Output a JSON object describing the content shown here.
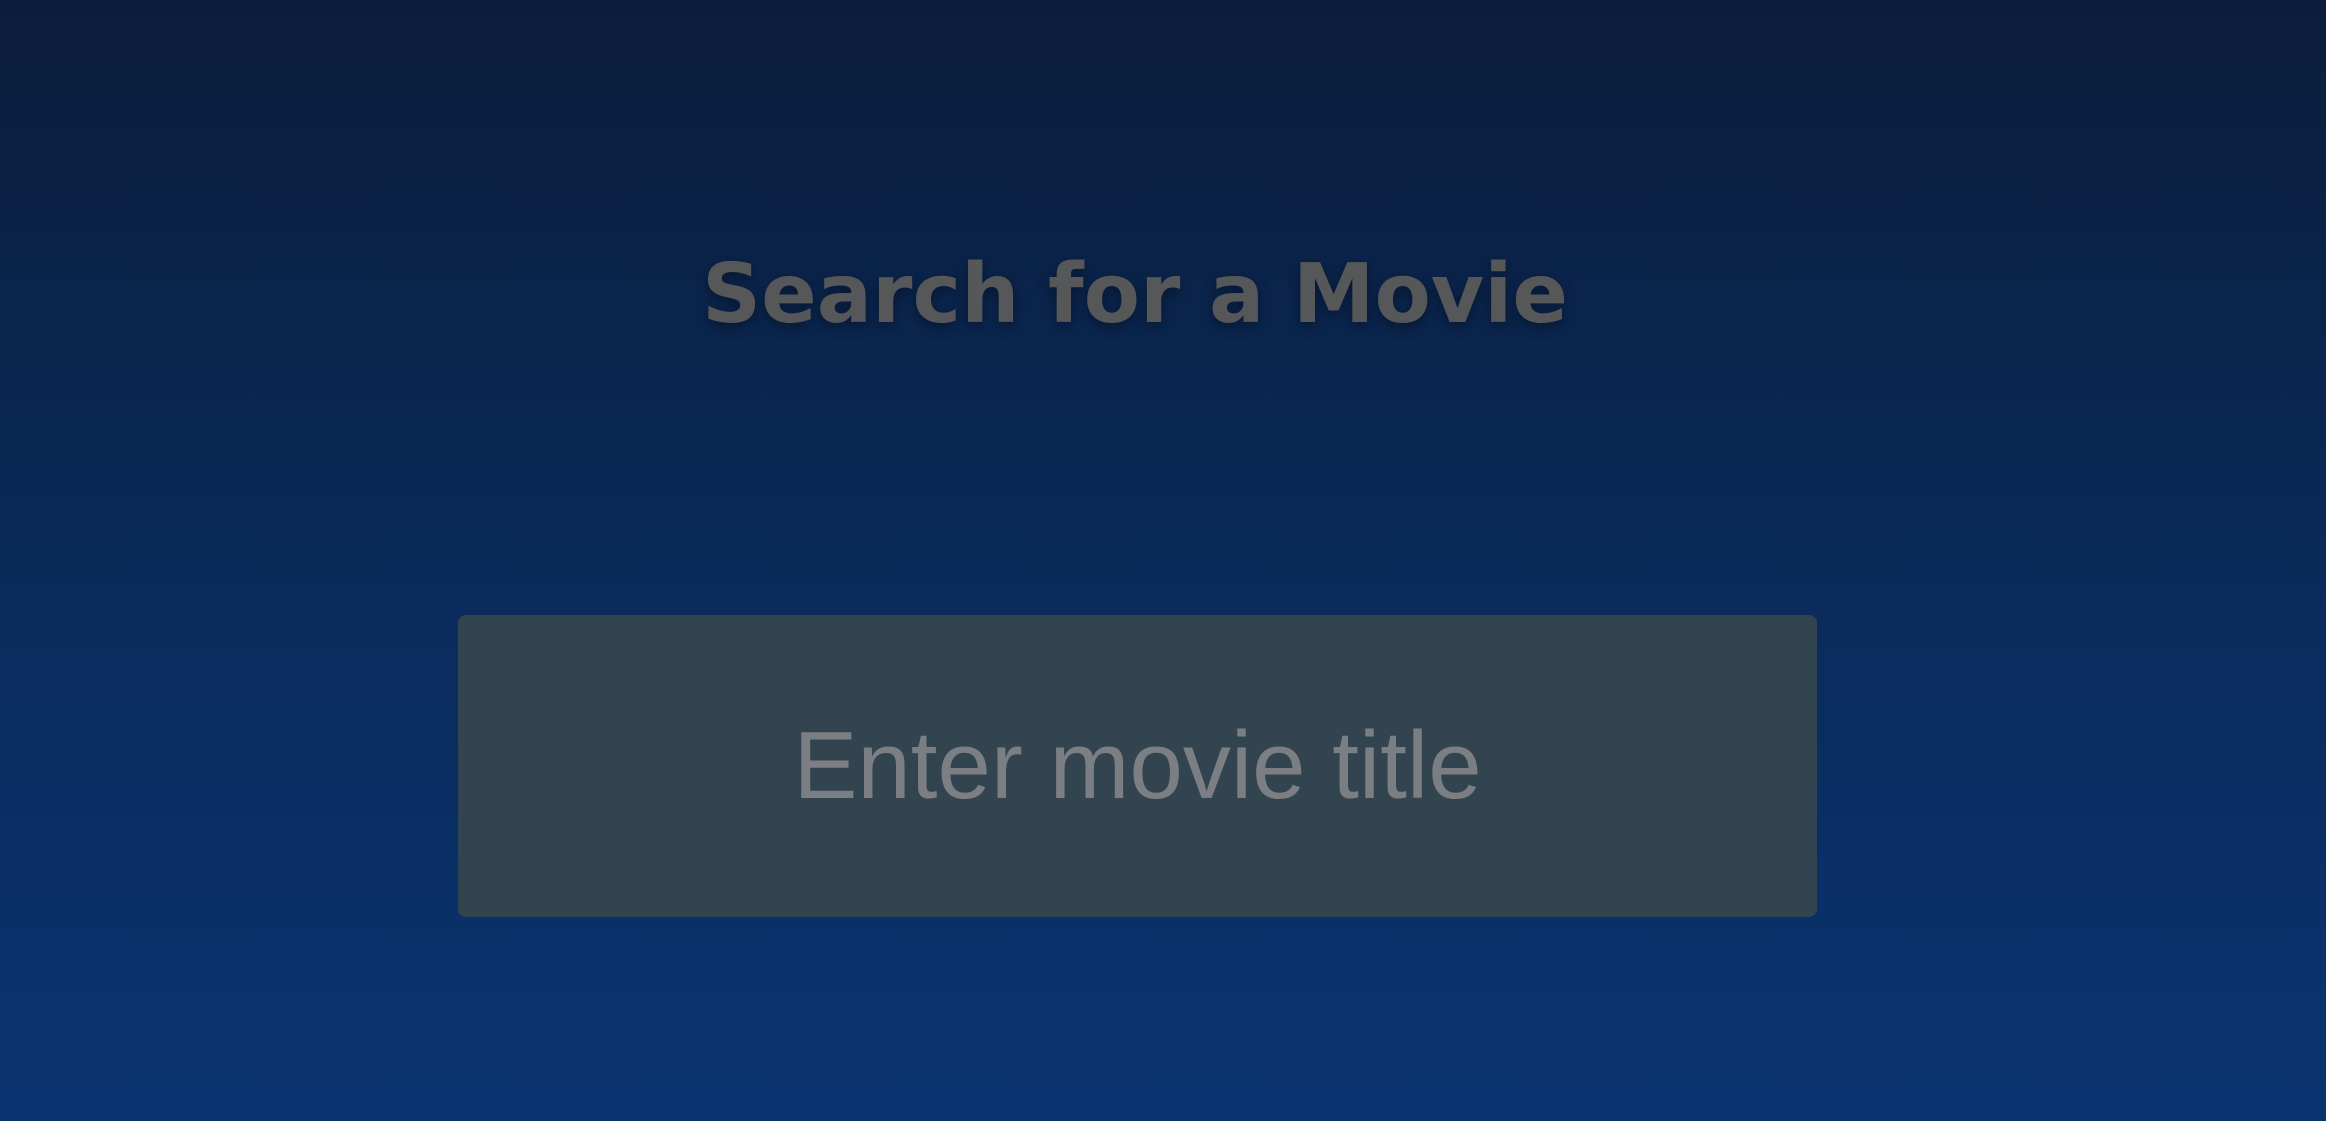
{
  "header": {
    "title": "Search for a Movie"
  },
  "search": {
    "placeholder": "Enter movie title",
    "value": ""
  },
  "colors": {
    "background_top": "#0b1d3a",
    "background_bottom": "#0a3470",
    "title_text": "#555759",
    "input_background": "#334451",
    "placeholder_text": "#7b7f83"
  }
}
